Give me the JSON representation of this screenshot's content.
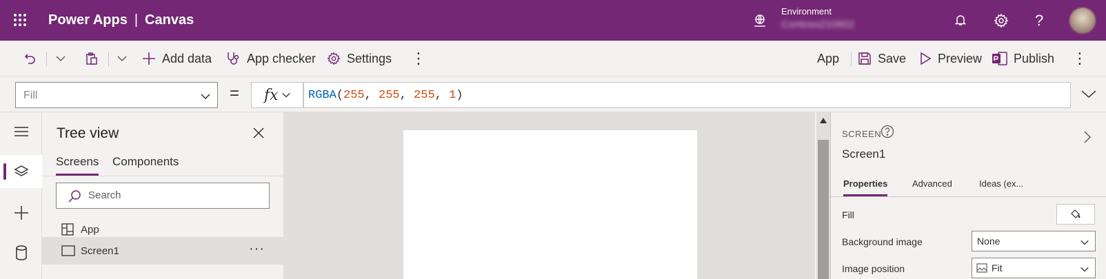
{
  "header": {
    "app_name": "Power Apps",
    "separator": "|",
    "app_kind": "Canvas",
    "environment_label": "Environment",
    "environment_name": "Contoso210602",
    "icons": [
      "waffle-icon",
      "environment-icon",
      "bell-icon",
      "gear-icon",
      "help-icon",
      "avatar"
    ],
    "help_glyph": "?"
  },
  "toolbar": {
    "add_data": "Add data",
    "app_checker": "App checker",
    "settings": "Settings",
    "more": "⋮",
    "app": "App",
    "save": "Save",
    "preview": "Preview",
    "publish": "Publish"
  },
  "formula_bar": {
    "property": "Fill",
    "equals": "=",
    "fx": "fx",
    "formula_fn": "RGBA",
    "formula_args": [
      "255",
      "255",
      "255",
      "1"
    ]
  },
  "tree_view": {
    "title": "Tree view",
    "tabs": [
      "Screens",
      "Components"
    ],
    "active_tab": "Screens",
    "search_placeholder": "Search",
    "items": [
      {
        "label": "App",
        "icon": "app-icon",
        "selected": false
      },
      {
        "label": "Screen1",
        "icon": "screen-icon",
        "selected": true,
        "more": "···"
      }
    ]
  },
  "properties_panel": {
    "kind": "SCREEN",
    "name": "Screen1",
    "tabs": [
      "Properties",
      "Advanced",
      "Ideas (ex..."
    ],
    "active_tab": "Properties",
    "fill_label": "Fill",
    "background_image_label": "Background image",
    "background_image_value": "None",
    "image_position_label": "Image position",
    "image_position_value": "Fit"
  },
  "colors": {
    "brand": "#742774",
    "canvas_background": "#e1dfdd",
    "screen_fill": "#ffffff"
  }
}
